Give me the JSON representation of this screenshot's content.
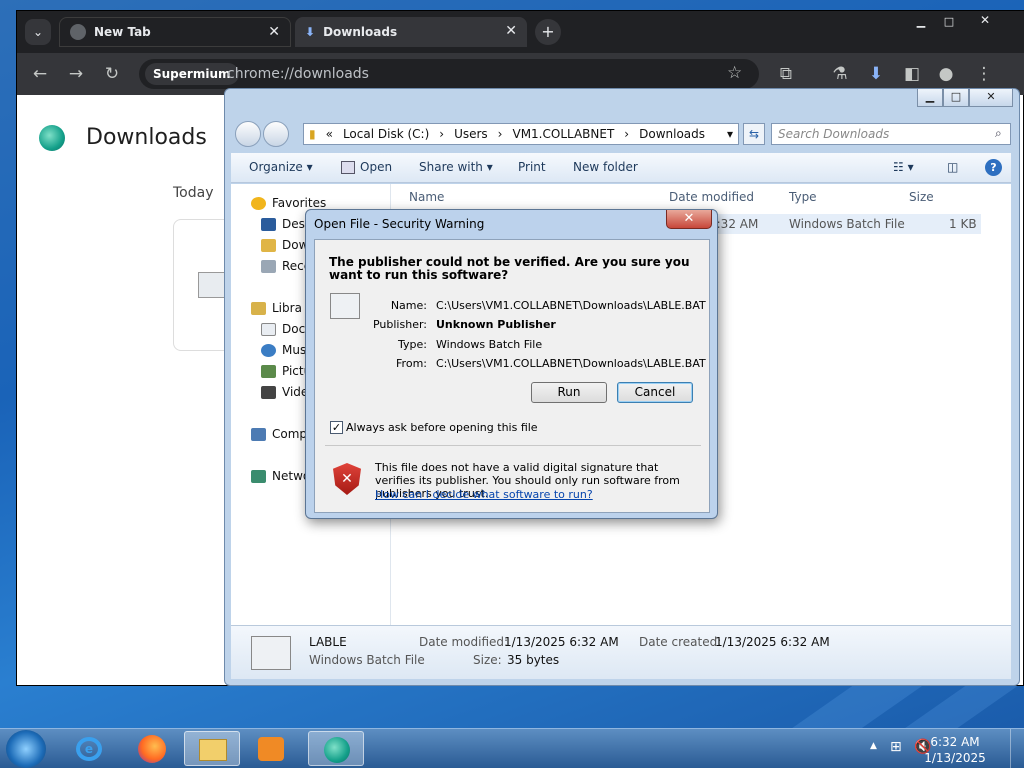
{
  "browser": {
    "tabs": [
      {
        "label": "New Tab",
        "active": false
      },
      {
        "label": "Downloads",
        "active": true
      }
    ],
    "new_tab_symbol": "+",
    "close_symbol": "✕",
    "omnibox": {
      "chip": "Supermium",
      "url": "chrome://downloads"
    },
    "page": {
      "title": "Downloads",
      "section": "Today"
    }
  },
  "explorer": {
    "breadcrumb": [
      "«",
      "Local Disk (C:)",
      "›",
      "Users",
      "›",
      "VM1.COLLABNET",
      "›",
      "Downloads"
    ],
    "search_placeholder": "Search Downloads",
    "commands": {
      "organize": "Organize ▾",
      "open": "Open",
      "share": "Share with ▾",
      "print": "Print",
      "new_folder": "New folder"
    },
    "nav": {
      "favorites": "Favorites",
      "desktop": "Desk",
      "downloads": "Dow",
      "recent": "Rece",
      "libraries": "Libra",
      "documents": "Doc",
      "music": "Mus",
      "pictures": "Pictu",
      "videos": "Vide",
      "computer": "Comp",
      "network": "Netwo"
    },
    "columns": {
      "name": "Name",
      "date": "Date modified",
      "type": "Type",
      "size": "Size"
    },
    "row": {
      "date": "6:32 AM",
      "type": "Windows Batch File",
      "size": "1 KB"
    },
    "details": {
      "name": "LABLE",
      "type": "Windows Batch File",
      "modified_label": "Date modified:",
      "modified": "1/13/2025 6:32 AM",
      "created_label": "Date created:",
      "created": "1/13/2025 6:32 AM",
      "size_label": "Size:",
      "size": "35 bytes"
    }
  },
  "dialog": {
    "title": "Open File - Security Warning",
    "close": "✕",
    "question": "The publisher could not be verified.  Are you sure you want to run this software?",
    "fields": {
      "name_label": "Name:",
      "name": "C:\\Users\\VM1.COLLABNET\\Downloads\\LABLE.BAT",
      "publisher_label": "Publisher:",
      "publisher": "Unknown Publisher",
      "type_label": "Type:",
      "type": "Windows Batch File",
      "from_label": "From:",
      "from": "C:\\Users\\VM1.COLLABNET\\Downloads\\LABLE.BAT"
    },
    "run": "Run",
    "cancel": "Cancel",
    "checkbox_label": "Always ask before opening this file",
    "checkbox_checked": true,
    "checkmark": "✓",
    "warning": "This file does not have a valid digital signature that verifies its publisher.  You should only run software from publishers you trust.",
    "link": "How can I decide what software to run?"
  },
  "taskbar": {
    "time": "6:32 AM",
    "date": "1/13/2025"
  },
  "colors": {
    "accent": "#1a63b8",
    "browser_dark": "#202124",
    "dialog_frame": "#bcd2ec",
    "link": "#0645ad"
  }
}
